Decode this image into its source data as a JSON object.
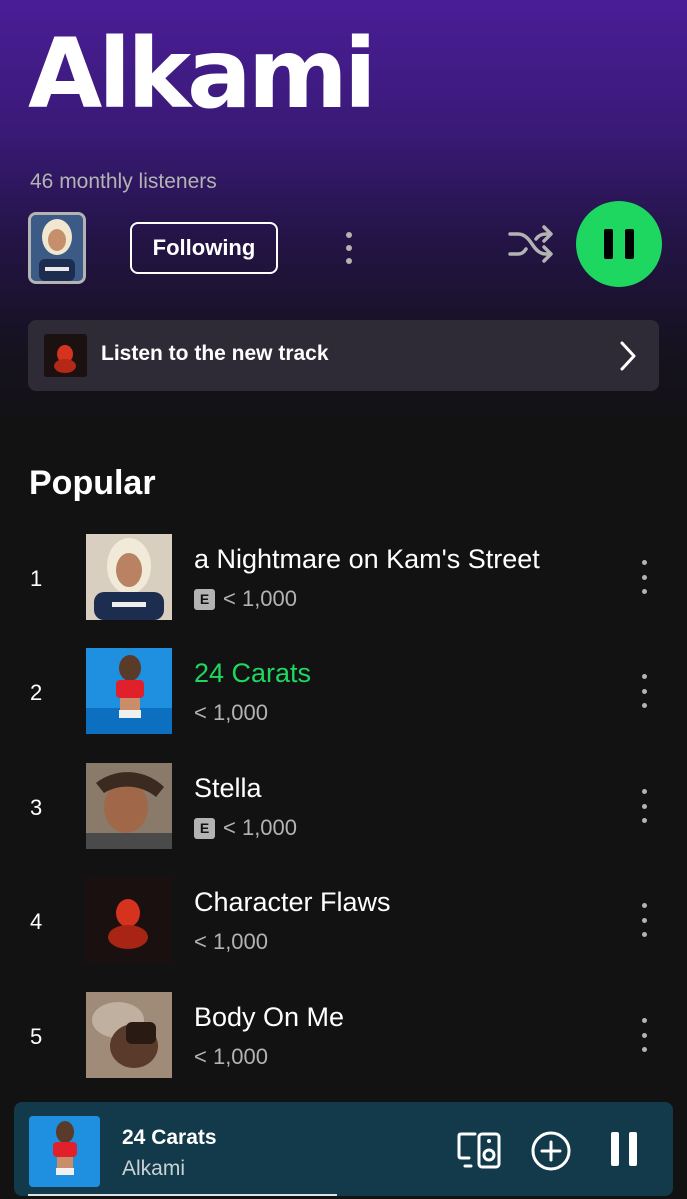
{
  "header": {
    "artist_name": "Alkami",
    "monthly_listeners": "46 monthly listeners",
    "follow_label": "Following",
    "gradient_color": "#4a1d96"
  },
  "banner": {
    "label": "Listen to the new track"
  },
  "popular": {
    "title": "Popular",
    "tracks": [
      {
        "rank": "1",
        "title": "a Nightmare on Kam's Street",
        "explicit": true,
        "explicit_label": "E",
        "plays": "< 1,000",
        "playing": false
      },
      {
        "rank": "2",
        "title": "24 Carats",
        "explicit": false,
        "plays": "< 1,000",
        "playing": true
      },
      {
        "rank": "3",
        "title": "Stella",
        "explicit": true,
        "explicit_label": "E",
        "plays": "< 1,000",
        "playing": false
      },
      {
        "rank": "4",
        "title": "Character Flaws",
        "explicit": false,
        "plays": "< 1,000",
        "playing": false
      },
      {
        "rank": "5",
        "title": "Body On Me",
        "explicit": false,
        "plays": "< 1,000",
        "playing": false
      }
    ]
  },
  "now_playing": {
    "title": "24 Carats",
    "artist": "Alkami",
    "progress": 0.49,
    "background": "#133a4a"
  },
  "colors": {
    "accent": "#1ed760",
    "background": "#121212",
    "secondary_text": "#b3b3b3"
  },
  "icons": {
    "shuffle": "shuffle-icon",
    "pause": "pause-icon",
    "more": "more-vertical-icon",
    "chevron": "chevron-right-icon",
    "device": "connect-device-icon",
    "add": "add-circle-icon"
  }
}
